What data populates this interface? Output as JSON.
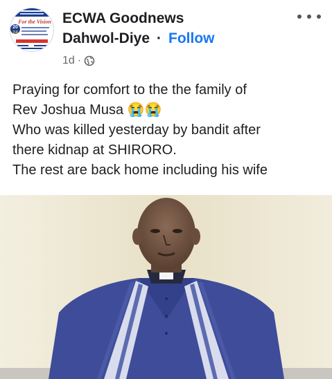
{
  "post": {
    "page_name_line1": "ECWA Goodnews",
    "page_name_line2": "Dahwol-Diye",
    "separator": "·",
    "follow_label": "Follow",
    "time": "1d",
    "meta_separator": "·",
    "audience_icon": "globe-icon",
    "more_icon": "more-options-icon",
    "text_lines": [
      "Praying for comfort to the the family of",
      "Rev Joshua Musa 😭😭",
      "Who was killed yesterday by bandit after",
      "there kidnap at SHIRORO.",
      "The rest are back home including his wife"
    ]
  },
  "avatar": {
    "year_top": "20",
    "year_bottom": "24",
    "banner_text": "For the Vision"
  },
  "colors": {
    "link": "#1877f2",
    "meta": "#65676b",
    "text": "#1c1e21"
  }
}
